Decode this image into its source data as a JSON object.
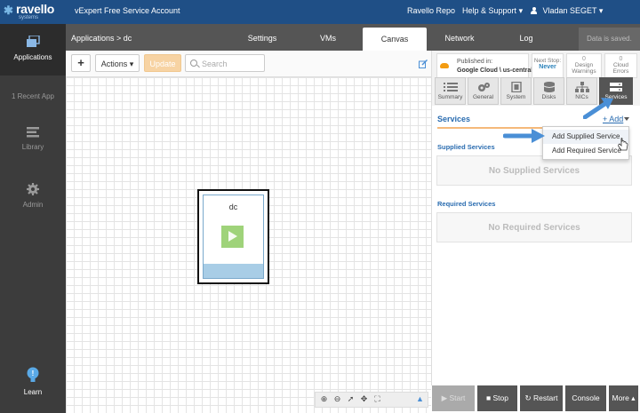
{
  "brand": {
    "name": "ravello",
    "sub": "systems"
  },
  "account": "vExpert Free Service Account",
  "topnav": {
    "repo": "Ravello Repo",
    "help": "Help & Support",
    "user": "Vladan SEGET"
  },
  "sidebar": {
    "items": [
      {
        "label": "Applications",
        "icon": "stack-icon"
      },
      {
        "label": "1 Recent App"
      },
      {
        "label": "Library",
        "icon": "library-icon"
      },
      {
        "label": "Admin",
        "icon": "gear-icon"
      },
      {
        "label": "Learn",
        "icon": "bulb-icon"
      }
    ]
  },
  "secondbar": {
    "breadcrumb": "Applications > dc",
    "tabs": [
      "Settings",
      "VMs",
      "Canvas",
      "Network",
      "Log"
    ],
    "active_tab": "Canvas",
    "saved": "Data is saved."
  },
  "toolbar": {
    "add": "+",
    "actions": "Actions",
    "update": "Update",
    "search_placeholder": "Search"
  },
  "canvas": {
    "vm_name": "dc"
  },
  "publish": {
    "label": "Published in:",
    "location": "Google Cloud \\ us-central1"
  },
  "status": {
    "next_stop_label": "Next Stop:",
    "next_stop_value": "Never",
    "warnings_count": "0",
    "warnings_label": "Design Warnings",
    "errors_count": "0",
    "errors_label": "Cloud Errors"
  },
  "panel_tabs": [
    "Summary",
    "General",
    "System",
    "Disks",
    "NICs",
    "Services"
  ],
  "services": {
    "title": "Services",
    "add": "+ Add",
    "supplied_header": "Supplied Services",
    "supplied_empty": "No Supplied Services",
    "required_header": "Required Services",
    "required_empty": "No Required Services",
    "menu": [
      "Add Supplied Service",
      "Add Required Service"
    ]
  },
  "bottom_buttons": [
    "Start",
    "Stop",
    "Restart",
    "Console",
    "More"
  ],
  "colors": {
    "topbar": "#1f4f86",
    "sidebar": "#3c3c3c",
    "accent": "#2a6cb0",
    "update": "#f7d3a3",
    "vm_play": "#9fd37a",
    "arrow": "#4a8fd6"
  }
}
